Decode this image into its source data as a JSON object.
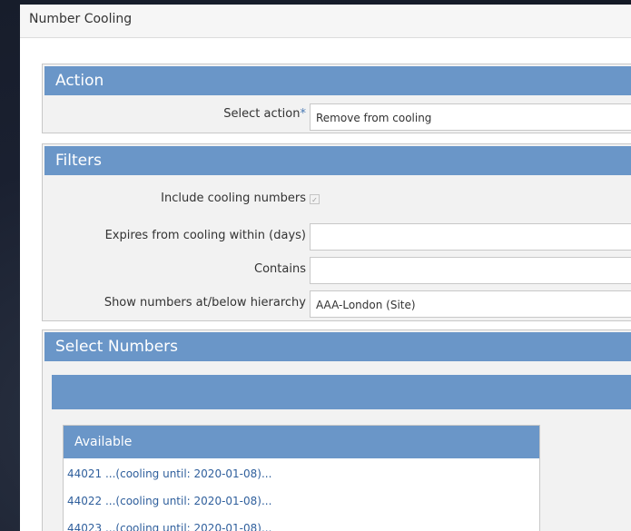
{
  "window": {
    "title": "Number Cooling"
  },
  "action_panel": {
    "header": "Action",
    "select_action_label": "Select action",
    "required_mark": "*",
    "select_action_value": "Remove from cooling"
  },
  "filters_panel": {
    "header": "Filters",
    "include_cooling_label": "Include cooling numbers",
    "include_cooling_checked": true,
    "expires_label": "Expires from cooling within (days)",
    "expires_value": "",
    "contains_label": "Contains",
    "contains_value": "",
    "hierarchy_label": "Show numbers at/below hierarchy",
    "hierarchy_value": "AAA-London (Site)"
  },
  "select_numbers_panel": {
    "header": "Select Numbers",
    "available": {
      "header": "Available",
      "items": [
        "44021 ...(cooling until: 2020-01-08)...",
        "44022 ...(cooling until: 2020-01-08)...",
        "44023 ...(cooling until: 2020-01-08)..."
      ]
    }
  },
  "colors": {
    "panel_header": "#6a96c8",
    "link_text": "#2f5f9c",
    "panel_bg": "#f2f2f2"
  }
}
